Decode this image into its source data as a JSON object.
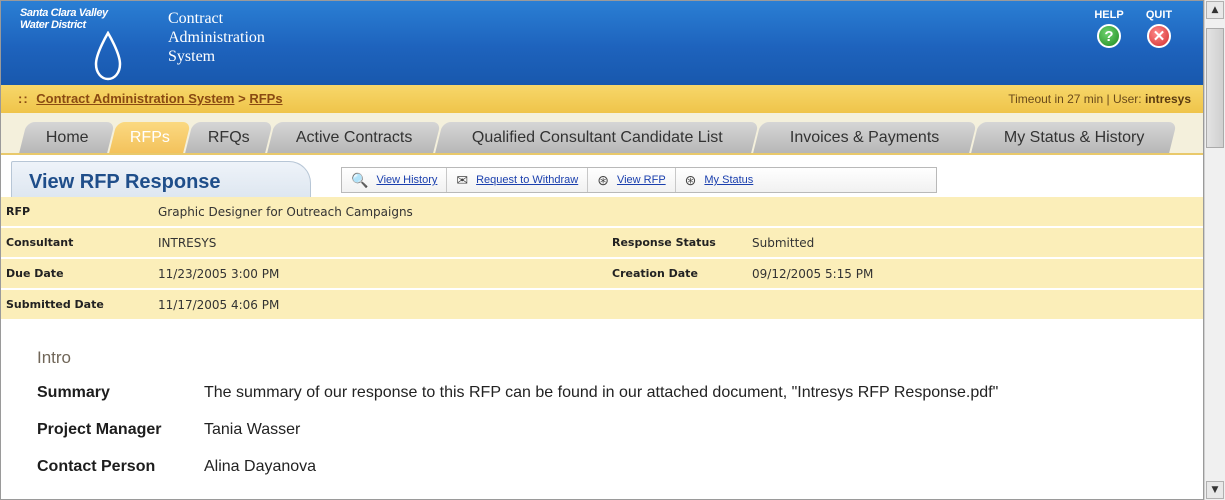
{
  "header": {
    "district_name": "Santa Clara Valley\nWater District",
    "system_title": [
      "Contract",
      "Administration",
      "System"
    ],
    "help_label": "HELP",
    "quit_label": "QUIT"
  },
  "breadcrumb": {
    "prefix": "::",
    "root": "Contract Administration System",
    "separator": ">",
    "current": "RFPs"
  },
  "session": {
    "timeout_text": "Timeout in 27 min |",
    "user_label": "User:",
    "user_name": "intresys"
  },
  "tabs": [
    {
      "label": "Home",
      "active": false
    },
    {
      "label": "RFPs",
      "active": true
    },
    {
      "label": "RFQs",
      "active": false
    },
    {
      "label": "Active Contracts",
      "active": false
    },
    {
      "label": "Qualified Consultant Candidate List",
      "active": false
    },
    {
      "label": "Invoices & Payments",
      "active": false
    },
    {
      "label": "My Status & History",
      "active": false
    }
  ],
  "page_title": "View RFP Response",
  "actions": [
    {
      "label": "View History",
      "icon": "magnifier-icon"
    },
    {
      "label": "Request to Withdraw",
      "icon": "withdraw-icon"
    },
    {
      "label": "View RFP",
      "icon": "document-icon"
    },
    {
      "label": "My Status",
      "icon": "status-icon"
    }
  ],
  "details": {
    "rfp_label": "RFP",
    "rfp_value": "Graphic Designer for Outreach Campaigns",
    "consultant_label": "Consultant",
    "consultant_value": "INTRESYS",
    "response_status_label": "Response Status",
    "response_status_value": "Submitted",
    "due_date_label": "Due Date",
    "due_date_value": "11/23/2005 3:00 PM",
    "creation_date_label": "Creation Date",
    "creation_date_value": "09/12/2005 5:15 PM",
    "submitted_date_label": "Submitted Date",
    "submitted_date_value": "11/17/2005 4:06 PM"
  },
  "intro": {
    "heading": "Intro",
    "summary_label": "Summary",
    "summary_value": "The summary of our response to this RFP can be found in our attached document, \"Intresys RFP Response.pdf\"",
    "project_manager_label": "Project Manager",
    "project_manager_value": "Tania Wasser",
    "contact_person_label": "Contact Person",
    "contact_person_value": "Alina Dayanova"
  },
  "colors": {
    "header_blue": "#1e63bd",
    "crumb_gold": "#efc44a",
    "detail_row": "#fbeeb9",
    "title_blue": "#1f4e8a",
    "link_blue": "#1a3fae"
  }
}
